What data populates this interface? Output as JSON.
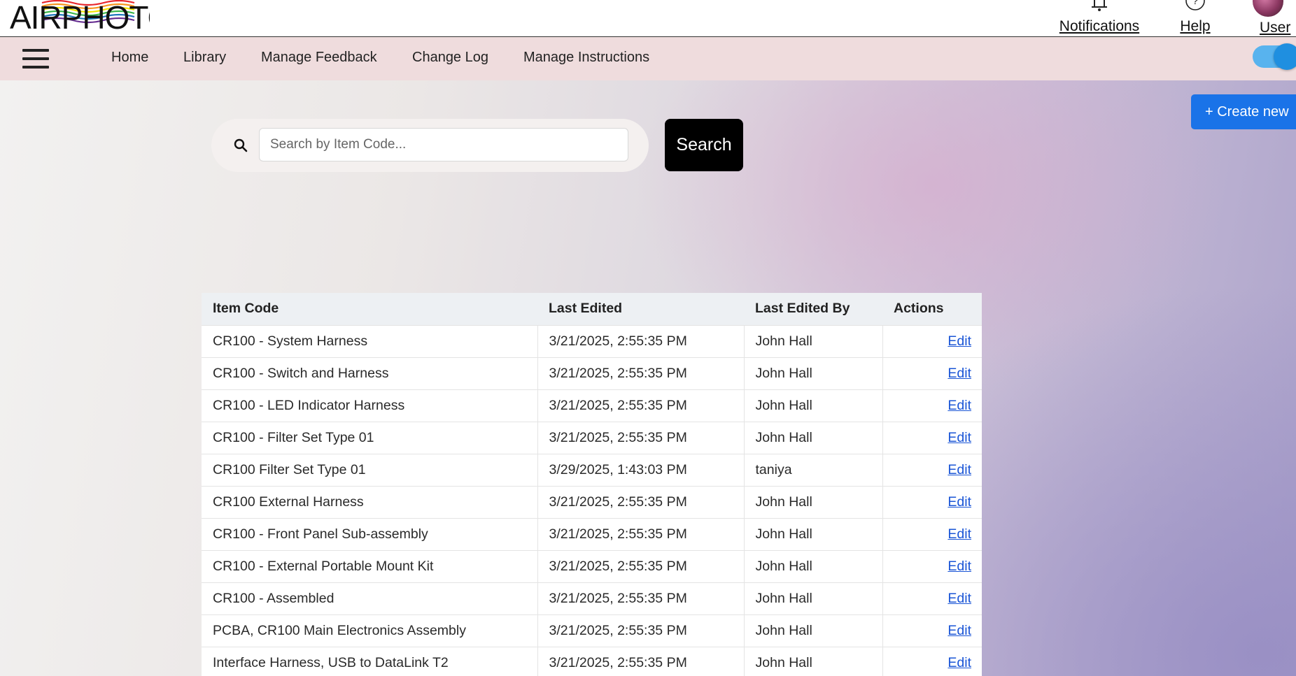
{
  "brand": {
    "logo_text": "AIRPHOTON"
  },
  "header": {
    "notifications_label": "Notifications",
    "help_label": "Help",
    "user_label": "User"
  },
  "nav": {
    "items": [
      {
        "label": "Home"
      },
      {
        "label": "Library"
      },
      {
        "label": "Manage Feedback"
      },
      {
        "label": "Change Log"
      },
      {
        "label": "Manage Instructions"
      }
    ],
    "toggle_on": true
  },
  "actions": {
    "create_label": "+ Create new"
  },
  "search": {
    "placeholder": "Search by Item Code...",
    "value": "",
    "button_label": "Search"
  },
  "table": {
    "columns": [
      "Item Code",
      "Last Edited",
      "Last Edited By",
      "Actions"
    ],
    "rows": [
      {
        "code": "CR100 - System Harness",
        "edited": "3/21/2025, 2:55:35 PM",
        "by": "John Hall",
        "action": "Edit"
      },
      {
        "code": "CR100 - Switch and Harness",
        "edited": "3/21/2025, 2:55:35 PM",
        "by": "John Hall",
        "action": "Edit"
      },
      {
        "code": "CR100 - LED Indicator Harness",
        "edited": "3/21/2025, 2:55:35 PM",
        "by": "John Hall",
        "action": "Edit"
      },
      {
        "code": "CR100 - Filter Set Type 01",
        "edited": "3/21/2025, 2:55:35 PM",
        "by": "John Hall",
        "action": "Edit"
      },
      {
        "code": "CR100 Filter Set Type 01",
        "edited": "3/29/2025, 1:43:03 PM",
        "by": "taniya",
        "action": "Edit"
      },
      {
        "code": "CR100 External Harness",
        "edited": "3/21/2025, 2:55:35 PM",
        "by": "John Hall",
        "action": "Edit"
      },
      {
        "code": "CR100 - Front Panel Sub-assembly",
        "edited": "3/21/2025, 2:55:35 PM",
        "by": "John Hall",
        "action": "Edit"
      },
      {
        "code": "CR100 - External Portable Mount Kit",
        "edited": "3/21/2025, 2:55:35 PM",
        "by": "John Hall",
        "action": "Edit"
      },
      {
        "code": "CR100 - Assembled",
        "edited": "3/21/2025, 2:55:35 PM",
        "by": "John Hall",
        "action": "Edit"
      },
      {
        "code": "PCBA, CR100 Main Electronics Assembly",
        "edited": "3/21/2025, 2:55:35 PM",
        "by": "John Hall",
        "action": "Edit"
      },
      {
        "code": "Interface Harness, USB to DataLink T2",
        "edited": "3/21/2025, 2:55:35 PM",
        "by": "John Hall",
        "action": "Edit"
      }
    ]
  },
  "colors": {
    "accent": "#1a73e8",
    "nav_bg": "#efdcdd",
    "link": "#1a55d6",
    "toggle": "#1f8fe0"
  },
  "icons": [
    "menu-icon",
    "search-icon",
    "bell-icon",
    "help-icon",
    "avatar"
  ]
}
